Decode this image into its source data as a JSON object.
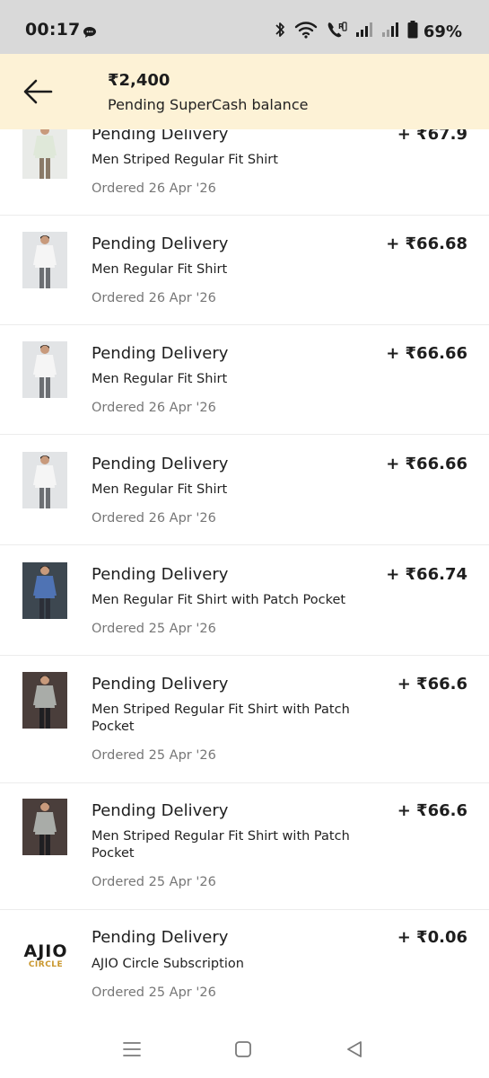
{
  "status_bar": {
    "time": "00:17",
    "battery": "69%",
    "icons": [
      "chat-bubble-icon",
      "bluetooth-icon",
      "wifi-icon",
      "wifi-calling-icon",
      "signal-icon",
      "signal-icon",
      "battery-icon"
    ]
  },
  "header": {
    "amount": "₹2,400",
    "subtitle": "Pending SuperCash balance",
    "back_icon": "arrow-left-icon",
    "background": "#fdf2d6"
  },
  "transactions": [
    {
      "status": "Pending Delivery",
      "product": "Men Striped Regular Fit Shirt",
      "date": "Ordered 26 Apr '26",
      "amount": "+ ₹67.9",
      "image": "shirt-light-green",
      "shirt_color": "#dfe8d9",
      "pants_color": "#8a7a68",
      "bg_color": "#e9ebe8"
    },
    {
      "status": "Pending Delivery",
      "product": "Men Regular Fit Shirt",
      "date": "Ordered 26 Apr '26",
      "amount": "+ ₹66.68",
      "image": "shirt-white",
      "shirt_color": "#f5f5f5",
      "pants_color": "#6c6f73",
      "bg_color": "#e2e4e6"
    },
    {
      "status": "Pending Delivery",
      "product": "Men Regular Fit Shirt",
      "date": "Ordered 26 Apr '26",
      "amount": "+ ₹66.66",
      "image": "shirt-white",
      "shirt_color": "#f5f5f5",
      "pants_color": "#6c6f73",
      "bg_color": "#e2e4e6"
    },
    {
      "status": "Pending Delivery",
      "product": "Men Regular Fit Shirt",
      "date": "Ordered 26 Apr '26",
      "amount": "+ ₹66.66",
      "image": "shirt-white",
      "shirt_color": "#f5f5f5",
      "pants_color": "#6c6f73",
      "bg_color": "#e2e4e6"
    },
    {
      "status": "Pending Delivery",
      "product": "Men Regular Fit Shirt with Patch Pocket",
      "date": "Ordered 25 Apr '26",
      "amount": "+ ₹66.74",
      "image": "shirt-blue",
      "shirt_color": "#4f73b4",
      "pants_color": "#2c2f38",
      "bg_color": "#3d4750"
    },
    {
      "status": "Pending Delivery",
      "product": "Men Striped Regular Fit Shirt with Patch Pocket",
      "date": "Ordered 25 Apr '26",
      "amount": "+ ₹66.6",
      "image": "shirt-grey-striped",
      "shirt_color": "#a9aca8",
      "pants_color": "#1f1f22",
      "bg_color": "#4a3e3b"
    },
    {
      "status": "Pending Delivery",
      "product": "Men Striped Regular Fit Shirt with Patch Pocket",
      "date": "Ordered 25 Apr '26",
      "amount": "+ ₹66.6",
      "image": "shirt-grey-striped",
      "shirt_color": "#a9aca8",
      "pants_color": "#1f1f22",
      "bg_color": "#4a3e3b"
    },
    {
      "status": "Pending Delivery",
      "product": "AJIO Circle Subscription",
      "date": "Ordered 25 Apr '26",
      "amount": "+ ₹0.06",
      "image": "ajio-circle-logo",
      "logo_word": "AJIO",
      "logo_sub": "CIRCLE"
    }
  ],
  "nav_bar": {
    "icons": [
      "recent-apps-icon",
      "home-icon",
      "back-triangle-icon"
    ]
  }
}
